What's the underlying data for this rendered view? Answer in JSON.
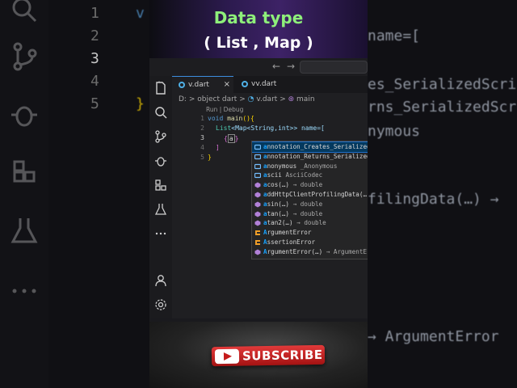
{
  "banner": {
    "title": "Data type",
    "subtitle": "( List , Map )"
  },
  "background": {
    "line_numbers": [
      "1",
      "2",
      "3",
      "4",
      "5"
    ],
    "code_right_fragments": [
      "name=[",
      "es_SerializedScri",
      "rns_SerializedScr",
      "nymous",
      "filingData(…) →",
      "→ ArgumentError"
    ]
  },
  "titlebar": {
    "back_arrow": "←",
    "forward_arrow": "→"
  },
  "tabs": [
    {
      "label": "v.dart",
      "close": "×"
    },
    {
      "label": "vv.dart"
    }
  ],
  "breadcrumb": {
    "drive": "D:",
    "sep": ">",
    "folder": "object dart",
    "file": "v.dart",
    "symbol": "main"
  },
  "codelens": "Run | Debug",
  "code": {
    "line_numbers": [
      "1",
      "2",
      "3",
      "4",
      "5"
    ],
    "line1": {
      "kw": "void",
      "fn": "main",
      "rest": "(){"
    },
    "line2": {
      "ty": "List",
      "rest": "<Map<String,int>> name=["
    },
    "line3": {
      "open": "{",
      "typed": "a",
      "close": "}"
    },
    "line4": {
      "text": "]"
    },
    "line5": {
      "text": "}"
    }
  },
  "suggestions": [
    {
      "match": "a",
      "label": "nnotation_Creates_SerializedScr",
      "detail": "",
      "kind": "variable"
    },
    {
      "match": "a",
      "label": "nnotation_Returns_SerializedScr",
      "detail": "",
      "kind": "variable"
    },
    {
      "match": "a",
      "label": "nonymous",
      "detail": "_Anonymous",
      "kind": "variable"
    },
    {
      "match": "a",
      "label": "scii",
      "detail": "AsciiCodec",
      "kind": "variable"
    },
    {
      "match": "a",
      "label": "cos(…)",
      "detail": "→ double",
      "kind": "method"
    },
    {
      "match": "a",
      "label": "ddHttpClientProfilingData(…)",
      "detail": "→",
      "kind": "method"
    },
    {
      "match": "a",
      "label": "sin(…)",
      "detail": "→ double",
      "kind": "method"
    },
    {
      "match": "a",
      "label": "tan(…)",
      "detail": "→ double",
      "kind": "method"
    },
    {
      "match": "a",
      "label": "tan2(…)",
      "detail": "→ double",
      "kind": "method"
    },
    {
      "match": "A",
      "label": "rgumentError",
      "detail": "",
      "kind": "class"
    },
    {
      "match": "A",
      "label": "ssertionError",
      "detail": "",
      "kind": "class"
    },
    {
      "match": "A",
      "label": "rgumentError(…)",
      "detail": "→ ArgumentError",
      "kind": "method"
    }
  ],
  "subscribe": {
    "label": "SUBSCRIBE"
  },
  "colors": {
    "banner_title": "#8ef07a",
    "accent": "#3c8dde",
    "subscribe_red": "#c51b1b"
  }
}
